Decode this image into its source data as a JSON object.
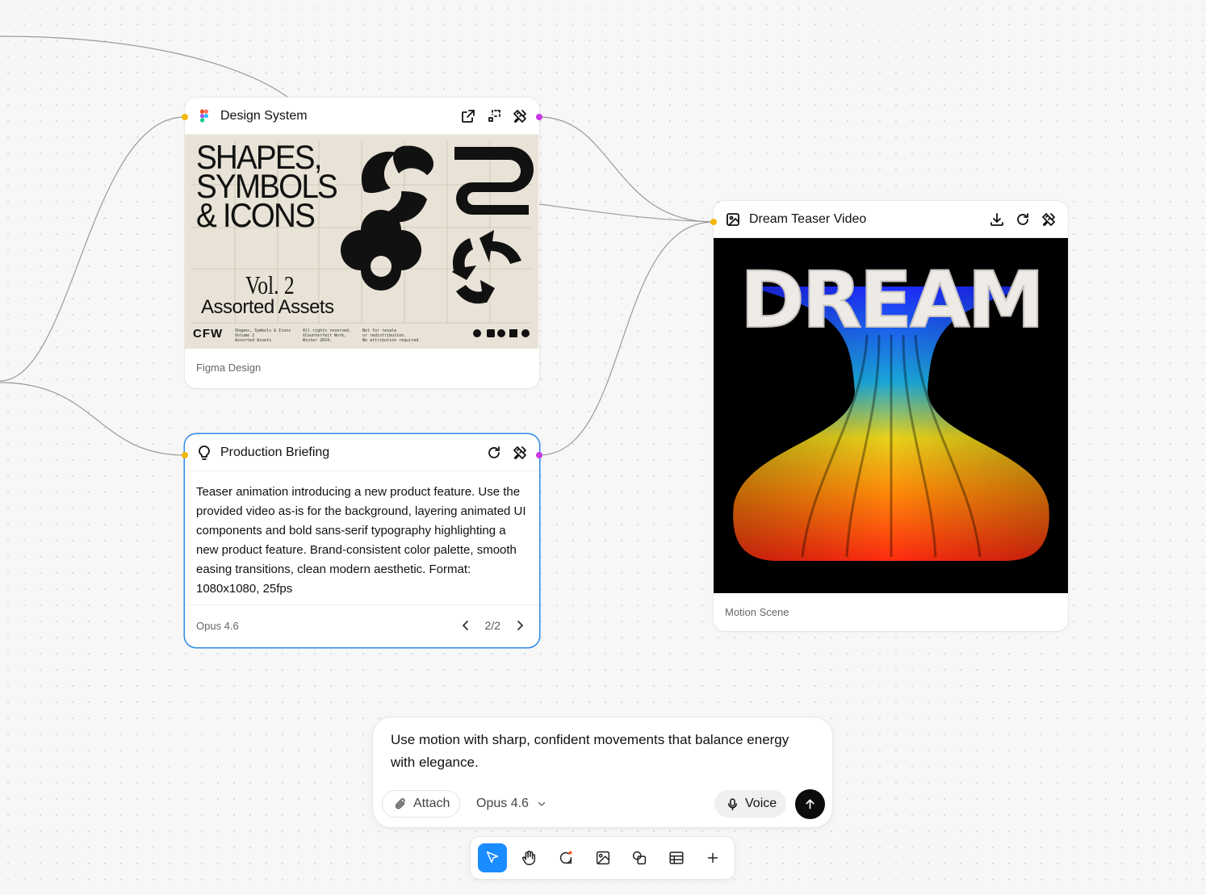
{
  "canvas": {
    "nodes": {
      "design_system": {
        "title": "Design System",
        "footer": "Figma Design",
        "poster": {
          "headline_1": "SHAPES,",
          "headline_2": "SYMBOLS",
          "headline_3": "& ICONS",
          "volume": "Vol. 2",
          "subtitle": "Assorted Assets",
          "brand": "CFW",
          "credits_1": "Shapes, Symbols & Icons\nVolume 2\nAssorted Assets",
          "credits_2": "All rights reserved.\n©Counterfeit Work,\nWinter 2024.",
          "credits_3": "Not for resale\nor redistribution.\nNo attribution required."
        }
      },
      "dream_video": {
        "title": "Dream Teaser Video",
        "footer": "Motion Scene",
        "artwork_text": "DREAM"
      },
      "production_briefing": {
        "title": "Production Briefing",
        "body": "Teaser animation introducing a new product feature. Use the provided video as-is for the background, layering animated UI components and bold sans-serif typography highlighting a new product feature. Brand-consistent color palette, smooth easing transitions, clean modern aesthetic. Format: 1080x1080, 25fps",
        "model": "Opus 4.6",
        "pager": "2/2"
      }
    }
  },
  "composer": {
    "prompt": "Use motion with sharp, confident movements that balance energy with elegance.",
    "attach_label": "Attach",
    "model_label": "Opus 4.6",
    "voice_label": "Voice"
  },
  "toolbar": {
    "tools": [
      "select-tool",
      "hand-tool",
      "comment-tool",
      "image-tool",
      "shapes-tool",
      "table-tool",
      "add-tool"
    ],
    "active": "select-tool"
  },
  "colors": {
    "accent": "#1a8cff",
    "port_in": "#f2b705",
    "port_out": "#c837e6",
    "selected_border": "#2b8ae6"
  }
}
